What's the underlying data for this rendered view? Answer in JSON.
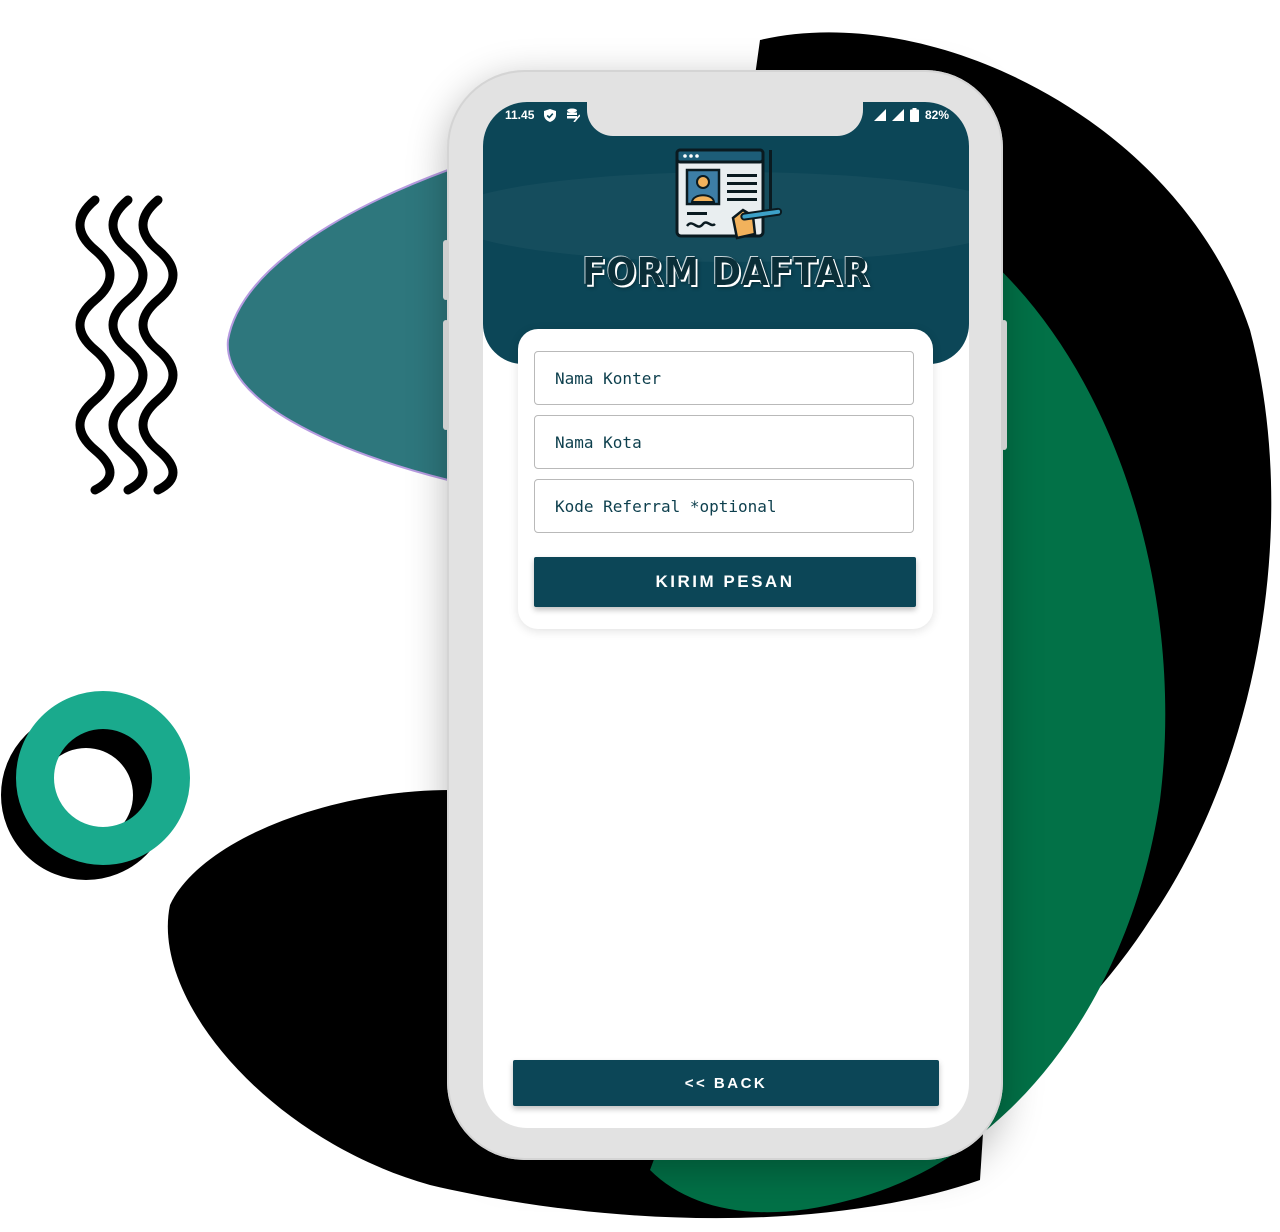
{
  "status_bar": {
    "time": "11.45",
    "battery": "82%"
  },
  "header": {
    "title": "FORM DAFTAR"
  },
  "form": {
    "fields": [
      {
        "placeholder": "Nama Konter"
      },
      {
        "placeholder": "Nama Kota"
      },
      {
        "placeholder": "Kode Referral *optional"
      }
    ],
    "submit_label": "KIRIM PESAN"
  },
  "footer": {
    "back_label": "<< BACK"
  },
  "colors": {
    "primary": "#0c4657",
    "teal_blob": "#2e777d",
    "green_blob": "#027147",
    "ring": "#1aaa8d",
    "dark": "#000000"
  }
}
